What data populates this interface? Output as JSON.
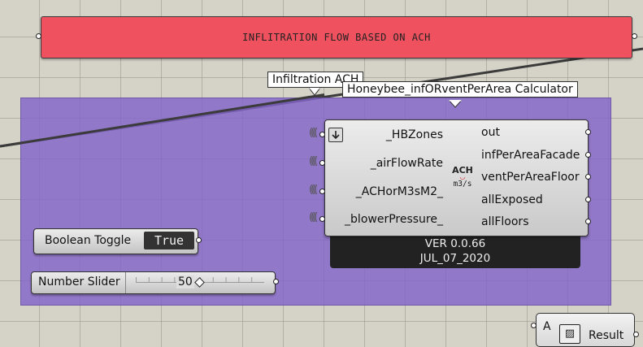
{
  "header_panel": {
    "text": "INFLITRATION FLOW BASED ON ACH"
  },
  "tooltips": {
    "group": "Infiltration ACH",
    "component": "Honeybee_infORventPerArea Calculator"
  },
  "component": {
    "inputs": [
      "_HBZones",
      "_airFlowRate",
      "_ACHorM3sM2_",
      "_blowerPressure_"
    ],
    "outputs": [
      "out",
      "infPerAreaFacade",
      "ventPerAreaFloor",
      "allExposed",
      "allFloors"
    ],
    "icon_line1": "ACH",
    "icon_line2": "m3/s",
    "version": "VER 0.0.66",
    "date": "JUL_07_2020"
  },
  "boolean_toggle": {
    "label": "Boolean Toggle",
    "value": "True"
  },
  "number_slider": {
    "label": "Number Slider",
    "value": "50"
  },
  "result_panel": {
    "prefix": "A",
    "label": "Result"
  },
  "colors": {
    "panel_red": "#f0515f",
    "group_purple": "#8364c8",
    "canvas": "#d5d2c7"
  }
}
